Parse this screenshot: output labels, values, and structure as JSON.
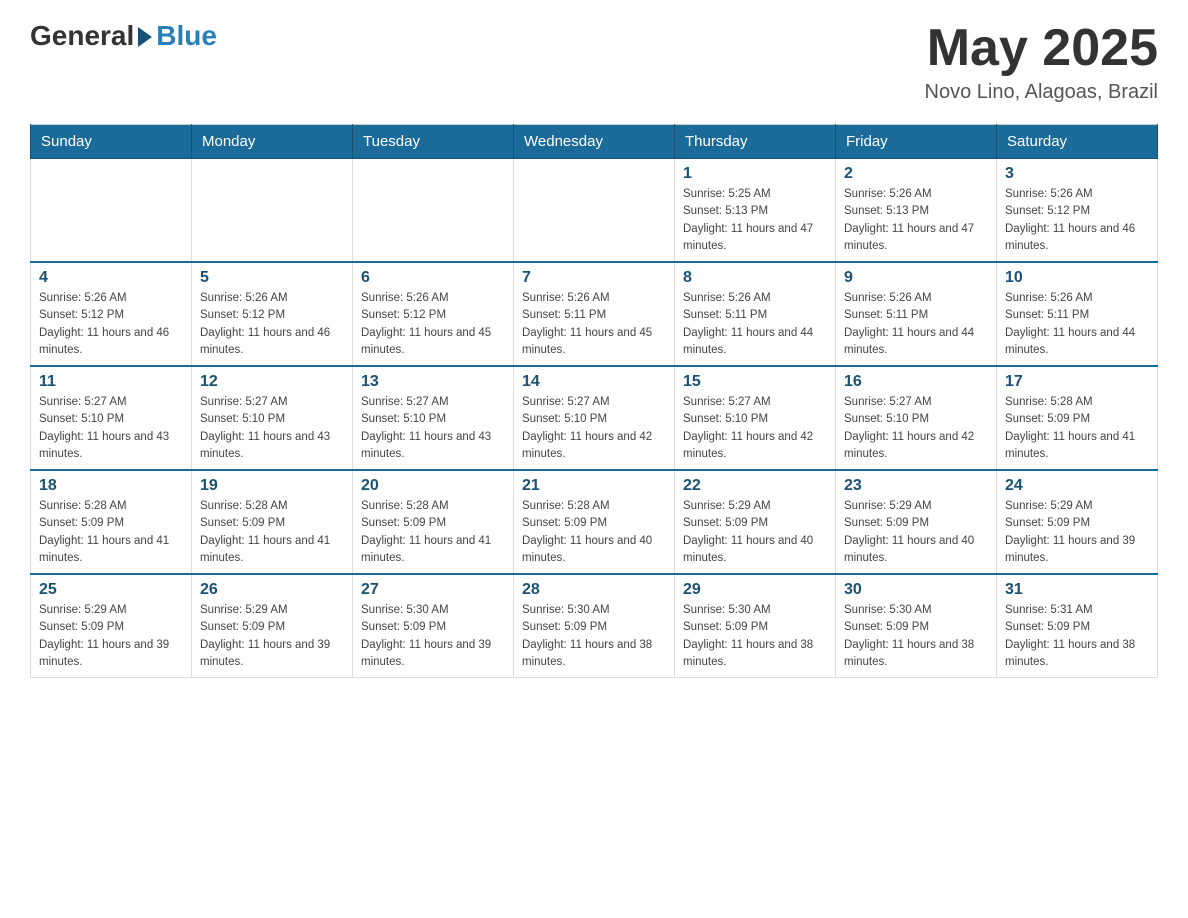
{
  "header": {
    "logo_general": "General",
    "logo_blue": "Blue",
    "month_year": "May 2025",
    "location": "Novo Lino, Alagoas, Brazil"
  },
  "days_of_week": [
    "Sunday",
    "Monday",
    "Tuesday",
    "Wednesday",
    "Thursday",
    "Friday",
    "Saturday"
  ],
  "weeks": [
    [
      {
        "day": "",
        "info": ""
      },
      {
        "day": "",
        "info": ""
      },
      {
        "day": "",
        "info": ""
      },
      {
        "day": "",
        "info": ""
      },
      {
        "day": "1",
        "info": "Sunrise: 5:25 AM\nSunset: 5:13 PM\nDaylight: 11 hours and 47 minutes."
      },
      {
        "day": "2",
        "info": "Sunrise: 5:26 AM\nSunset: 5:13 PM\nDaylight: 11 hours and 47 minutes."
      },
      {
        "day": "3",
        "info": "Sunrise: 5:26 AM\nSunset: 5:12 PM\nDaylight: 11 hours and 46 minutes."
      }
    ],
    [
      {
        "day": "4",
        "info": "Sunrise: 5:26 AM\nSunset: 5:12 PM\nDaylight: 11 hours and 46 minutes."
      },
      {
        "day": "5",
        "info": "Sunrise: 5:26 AM\nSunset: 5:12 PM\nDaylight: 11 hours and 46 minutes."
      },
      {
        "day": "6",
        "info": "Sunrise: 5:26 AM\nSunset: 5:12 PM\nDaylight: 11 hours and 45 minutes."
      },
      {
        "day": "7",
        "info": "Sunrise: 5:26 AM\nSunset: 5:11 PM\nDaylight: 11 hours and 45 minutes."
      },
      {
        "day": "8",
        "info": "Sunrise: 5:26 AM\nSunset: 5:11 PM\nDaylight: 11 hours and 44 minutes."
      },
      {
        "day": "9",
        "info": "Sunrise: 5:26 AM\nSunset: 5:11 PM\nDaylight: 11 hours and 44 minutes."
      },
      {
        "day": "10",
        "info": "Sunrise: 5:26 AM\nSunset: 5:11 PM\nDaylight: 11 hours and 44 minutes."
      }
    ],
    [
      {
        "day": "11",
        "info": "Sunrise: 5:27 AM\nSunset: 5:10 PM\nDaylight: 11 hours and 43 minutes."
      },
      {
        "day": "12",
        "info": "Sunrise: 5:27 AM\nSunset: 5:10 PM\nDaylight: 11 hours and 43 minutes."
      },
      {
        "day": "13",
        "info": "Sunrise: 5:27 AM\nSunset: 5:10 PM\nDaylight: 11 hours and 43 minutes."
      },
      {
        "day": "14",
        "info": "Sunrise: 5:27 AM\nSunset: 5:10 PM\nDaylight: 11 hours and 42 minutes."
      },
      {
        "day": "15",
        "info": "Sunrise: 5:27 AM\nSunset: 5:10 PM\nDaylight: 11 hours and 42 minutes."
      },
      {
        "day": "16",
        "info": "Sunrise: 5:27 AM\nSunset: 5:10 PM\nDaylight: 11 hours and 42 minutes."
      },
      {
        "day": "17",
        "info": "Sunrise: 5:28 AM\nSunset: 5:09 PM\nDaylight: 11 hours and 41 minutes."
      }
    ],
    [
      {
        "day": "18",
        "info": "Sunrise: 5:28 AM\nSunset: 5:09 PM\nDaylight: 11 hours and 41 minutes."
      },
      {
        "day": "19",
        "info": "Sunrise: 5:28 AM\nSunset: 5:09 PM\nDaylight: 11 hours and 41 minutes."
      },
      {
        "day": "20",
        "info": "Sunrise: 5:28 AM\nSunset: 5:09 PM\nDaylight: 11 hours and 41 minutes."
      },
      {
        "day": "21",
        "info": "Sunrise: 5:28 AM\nSunset: 5:09 PM\nDaylight: 11 hours and 40 minutes."
      },
      {
        "day": "22",
        "info": "Sunrise: 5:29 AM\nSunset: 5:09 PM\nDaylight: 11 hours and 40 minutes."
      },
      {
        "day": "23",
        "info": "Sunrise: 5:29 AM\nSunset: 5:09 PM\nDaylight: 11 hours and 40 minutes."
      },
      {
        "day": "24",
        "info": "Sunrise: 5:29 AM\nSunset: 5:09 PM\nDaylight: 11 hours and 39 minutes."
      }
    ],
    [
      {
        "day": "25",
        "info": "Sunrise: 5:29 AM\nSunset: 5:09 PM\nDaylight: 11 hours and 39 minutes."
      },
      {
        "day": "26",
        "info": "Sunrise: 5:29 AM\nSunset: 5:09 PM\nDaylight: 11 hours and 39 minutes."
      },
      {
        "day": "27",
        "info": "Sunrise: 5:30 AM\nSunset: 5:09 PM\nDaylight: 11 hours and 39 minutes."
      },
      {
        "day": "28",
        "info": "Sunrise: 5:30 AM\nSunset: 5:09 PM\nDaylight: 11 hours and 38 minutes."
      },
      {
        "day": "29",
        "info": "Sunrise: 5:30 AM\nSunset: 5:09 PM\nDaylight: 11 hours and 38 minutes."
      },
      {
        "day": "30",
        "info": "Sunrise: 5:30 AM\nSunset: 5:09 PM\nDaylight: 11 hours and 38 minutes."
      },
      {
        "day": "31",
        "info": "Sunrise: 5:31 AM\nSunset: 5:09 PM\nDaylight: 11 hours and 38 minutes."
      }
    ]
  ]
}
